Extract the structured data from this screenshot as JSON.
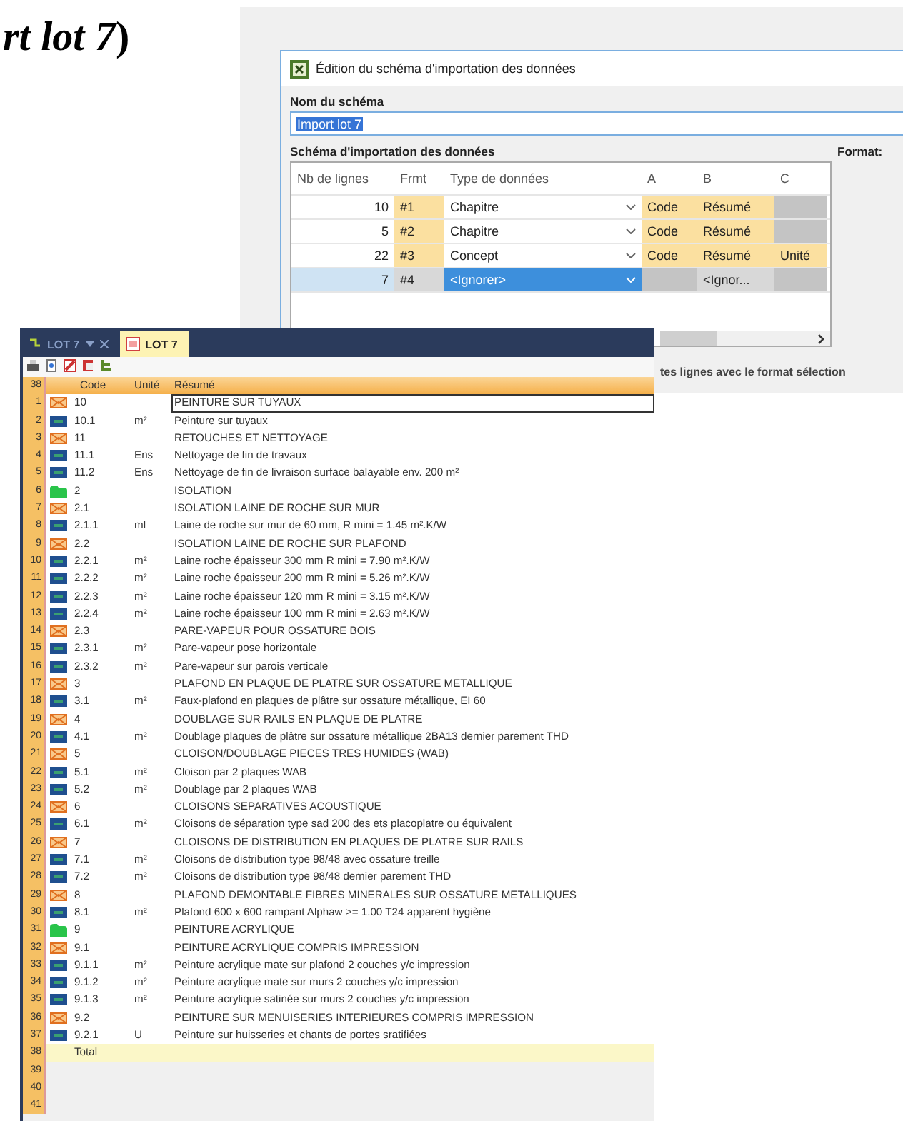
{
  "heading": "rt lot 7",
  "paren": ")",
  "dialog": {
    "title": "Édition du schéma d'importation des données",
    "name_label": "Nom du schéma",
    "name_value": "Import lot 7",
    "schema_label": "Schéma d'importation des données",
    "format_label": "Format:",
    "columns": [
      "Nb de lignes",
      "Frmt",
      "Type de données",
      "A",
      "B",
      "C"
    ],
    "rows": [
      {
        "lines": "10",
        "format": "#1",
        "type": "Chapitre",
        "a": "Code",
        "b": "Résumé",
        "selected": false
      },
      {
        "lines": "5",
        "format": "#2",
        "type": "Chapitre",
        "a": "Code",
        "b": "Résumé",
        "selected": false
      },
      {
        "lines": "22",
        "format": "#3",
        "type": "Concept",
        "a": "Code",
        "b": "Résumé",
        "c": "Unité",
        "selected": false
      },
      {
        "lines": "7",
        "format": "#4",
        "type": "<Ignorer>",
        "b": "<Ignor...",
        "selected": true
      }
    ],
    "footer_text": "tes lignes avec le format sélection"
  },
  "window": {
    "tabs": [
      {
        "label": "LOT 7",
        "selected": false
      },
      {
        "label": "LOT 7",
        "selected": true
      }
    ],
    "table": {
      "count": "38",
      "columns": [
        "Code",
        "Unité",
        "Résumé"
      ],
      "rows": [
        {
          "n": "1",
          "kind": "chapter",
          "code": "10",
          "text": "PEINTURE SUR TUYAUX",
          "selected": true
        },
        {
          "n": "2",
          "kind": "item",
          "code": "10.1",
          "unit": "m²",
          "text": "Peinture sur tuyaux",
          "selected": false
        },
        {
          "n": "3",
          "kind": "chapter",
          "code": "11",
          "text": "RETOUCHES ET NETTOYAGE",
          "selected": false
        },
        {
          "n": "4",
          "kind": "item",
          "code": "11.1",
          "unit": "Ens",
          "text": "Nettoyage de fin de travaux",
          "selected": false
        },
        {
          "n": "5",
          "kind": "item",
          "code": "11.2",
          "unit": "Ens",
          "text": "Nettoyage de fin de livraison surface balayable env. 200 m²",
          "selected": false
        },
        {
          "n": "6",
          "kind": "group",
          "code": "2",
          "text": "ISOLATION",
          "selected": false
        },
        {
          "n": "7",
          "kind": "chapter",
          "code": "2.1",
          "text": "ISOLATION LAINE DE ROCHE SUR MUR",
          "selected": false
        },
        {
          "n": "8",
          "kind": "item",
          "code": "2.1.1",
          "unit": "ml",
          "text": "Laine de roche sur mur de 60 mm, R mini = 1.45 m².K/W",
          "selected": false
        },
        {
          "n": "9",
          "kind": "chapter",
          "code": "2.2",
          "text": "ISOLATION LAINE DE ROCHE SUR PLAFOND",
          "selected": false
        },
        {
          "n": "10",
          "kind": "item",
          "code": "2.2.1",
          "unit": "m²",
          "text": "Laine roche épaisseur 300 mm R mini = 7.90 m².K/W",
          "selected": false
        },
        {
          "n": "11",
          "kind": "item",
          "code": "2.2.2",
          "unit": "m²",
          "text": "Laine roche épaisseur 200 mm R mini = 5.26 m².K/W",
          "selected": false
        },
        {
          "n": "12",
          "kind": "item",
          "code": "2.2.3",
          "unit": "m²",
          "text": "Laine roche épaisseur 120 mm R mini = 3.15 m².K/W",
          "selected": false
        },
        {
          "n": "13",
          "kind": "item",
          "code": "2.2.4",
          "unit": "m²",
          "text": "Laine roche épaisseur 100 mm R mini = 2.63 m².K/W",
          "selected": false
        },
        {
          "n": "14",
          "kind": "chapter",
          "code": "2.3",
          "text": "PARE-VAPEUR POUR OSSATURE BOIS",
          "selected": false
        },
        {
          "n": "15",
          "kind": "item",
          "code": "2.3.1",
          "unit": "m²",
          "text": "Pare-vapeur pose horizontale",
          "selected": false
        },
        {
          "n": "16",
          "kind": "item",
          "code": "2.3.2",
          "unit": "m²",
          "text": "Pare-vapeur sur parois verticale",
          "selected": false
        },
        {
          "n": "17",
          "kind": "chapter",
          "code": "3",
          "text": "PLAFOND EN PLAQUE DE PLATRE SUR OSSATURE METALLIQUE",
          "selected": false
        },
        {
          "n": "18",
          "kind": "item",
          "code": "3.1",
          "unit": "m²",
          "text": "Faux-plafond en plaques de plâtre sur ossature métallique, EI 60",
          "selected": false
        },
        {
          "n": "19",
          "kind": "chapter",
          "code": "4",
          "text": "DOUBLAGE SUR RAILS EN PLAQUE DE PLATRE",
          "selected": false
        },
        {
          "n": "20",
          "kind": "item",
          "code": "4.1",
          "unit": "m²",
          "text": "Doublage plaques de plâtre sur ossature métallique 2BA13 dernier parement THD",
          "selected": false
        },
        {
          "n": "21",
          "kind": "chapter",
          "code": "5",
          "text": "CLOISON/DOUBLAGE PIECES TRES HUMIDES (WAB)",
          "selected": false
        },
        {
          "n": "22",
          "kind": "item",
          "code": "5.1",
          "unit": "m²",
          "text": "Cloison par 2 plaques WAB",
          "selected": false
        },
        {
          "n": "23",
          "kind": "item",
          "code": "5.2",
          "unit": "m²",
          "text": "Doublage par 2 plaques WAB",
          "selected": false
        },
        {
          "n": "24",
          "kind": "chapter",
          "code": "6",
          "text": "CLOISONS SEPARATIVES ACOUSTIQUE",
          "selected": false
        },
        {
          "n": "25",
          "kind": "item",
          "code": "6.1",
          "unit": "m²",
          "text": "Cloisons de séparation type sad 200 des ets placoplatre ou équivalent",
          "selected": false
        },
        {
          "n": "26",
          "kind": "chapter",
          "code": "7",
          "text": "CLOISONS DE DISTRIBUTION EN PLAQUES DE PLATRE SUR RAILS",
          "selected": false
        },
        {
          "n": "27",
          "kind": "item",
          "code": "7.1",
          "unit": "m²",
          "text": "Cloisons de distribution type 98/48 avec ossature treille",
          "selected": false
        },
        {
          "n": "28",
          "kind": "item",
          "code": "7.2",
          "unit": "m²",
          "text": "Cloisons de distribution type 98/48 dernier parement THD",
          "selected": false
        },
        {
          "n": "29",
          "kind": "chapter",
          "code": "8",
          "text": "PLAFOND DEMONTABLE FIBRES MINERALES SUR OSSATURE METALLIQUES",
          "selected": false
        },
        {
          "n": "30",
          "kind": "item",
          "code": "8.1",
          "unit": "m²",
          "text": "Plafond 600 x 600 rampant Alphaw >= 1.00  T24  apparent hygiène",
          "selected": false
        },
        {
          "n": "31",
          "kind": "group",
          "code": "9",
          "text": "PEINTURE ACRYLIQUE",
          "selected": false
        },
        {
          "n": "32",
          "kind": "chapter",
          "code": "9.1",
          "text": "PEINTURE ACRYLIQUE COMPRIS IMPRESSION",
          "selected": false
        },
        {
          "n": "33",
          "kind": "item",
          "code": "9.1.1",
          "unit": "m²",
          "text": "Peinture acrylique mate sur plafond 2 couches y/c impression",
          "selected": false
        },
        {
          "n": "34",
          "kind": "item",
          "code": "9.1.2",
          "unit": "m²",
          "text": "Peinture acrylique mate sur murs 2 couches  y/c impression",
          "selected": false
        },
        {
          "n": "35",
          "kind": "item",
          "code": "9.1.3",
          "unit": "m²",
          "text": "Peinture acrylique satinée sur murs 2 couches  y/c impression",
          "selected": false
        },
        {
          "n": "36",
          "kind": "chapter",
          "code": "9.2",
          "text": "PEINTURE SUR MENUISERIES INTERIEURES COMPRIS IMPRESSION",
          "selected": false
        },
        {
          "n": "37",
          "kind": "item",
          "code": "9.2.1",
          "unit": "U",
          "text": "Peinture sur huisseries et chants de portes sratifiées",
          "selected": false
        }
      ],
      "total": {
        "n": "38",
        "label": "Total"
      },
      "empty_rows": [
        "39",
        "40",
        "41"
      ]
    }
  }
}
